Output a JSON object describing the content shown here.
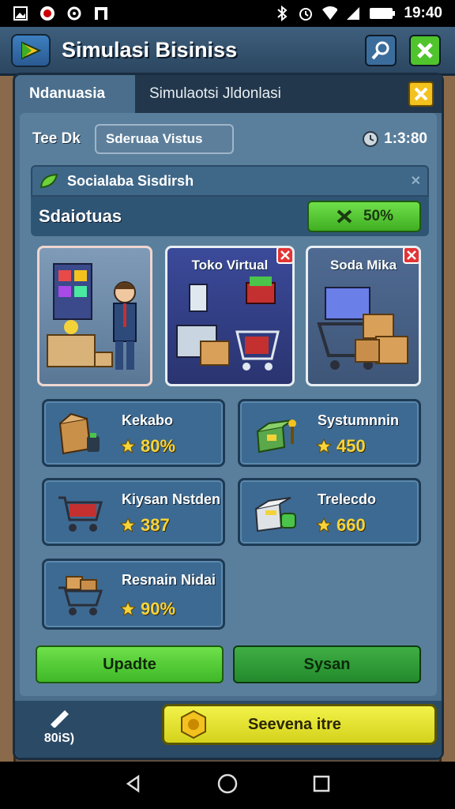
{
  "status_bar": {
    "time": "19:40"
  },
  "header": {
    "title": "Simulasi Bisiniss"
  },
  "tabs": [
    {
      "label": "Ndanuasia"
    },
    {
      "label": "Simulaotsi Jldonlasi"
    }
  ],
  "toolbar": {
    "label": "Tee Dk",
    "search_value": "Sderuaa Vistus",
    "clock": "1:3:80"
  },
  "dropdown": {
    "label": "Socialaba Sisdirsh"
  },
  "stat": {
    "label": "Sdaiotuas",
    "percent": "50%"
  },
  "cards": [
    {
      "title": ""
    },
    {
      "title": "Toko Virtual"
    },
    {
      "title": "Soda Mika"
    }
  ],
  "tiles": [
    {
      "title": "Kekabo",
      "value": "80%"
    },
    {
      "title": "Systumnnin",
      "value": "450"
    },
    {
      "title": "Kiysan Nstden",
      "value": "387"
    },
    {
      "title": "Trelecdo",
      "value": "660"
    },
    {
      "title": "Resnain Nidai",
      "value": "90%"
    }
  ],
  "buttons": {
    "update": "Upadte",
    "sysan": "Sysan"
  },
  "footer": {
    "left_label": "80iS)",
    "main_button": "Seevena itre"
  },
  "colors": {
    "accent_green": "#3fae22",
    "accent_yellow": "#f3c21f",
    "panel_blue": "#4a6e8c"
  }
}
